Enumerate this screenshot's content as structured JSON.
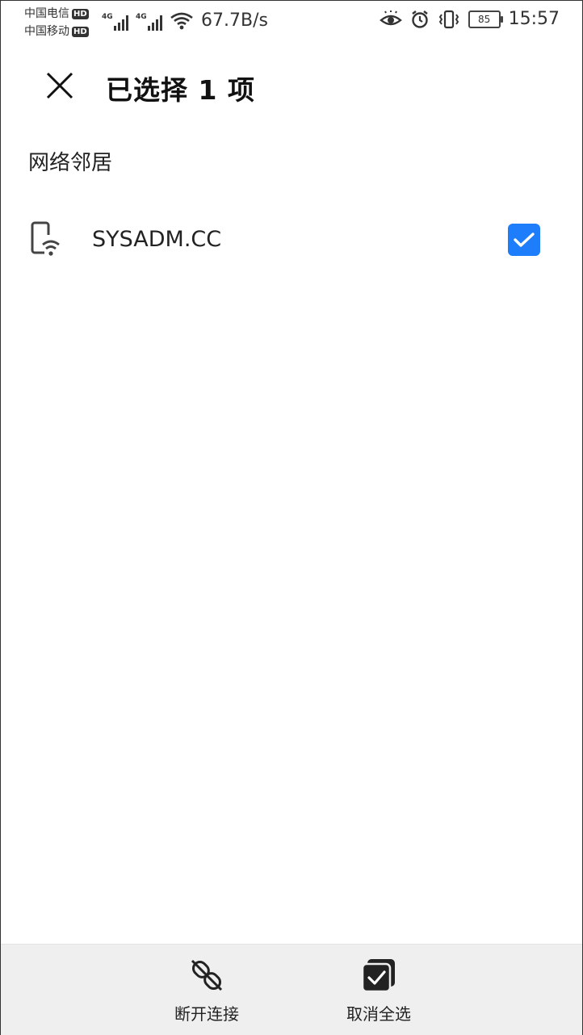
{
  "status_bar": {
    "carrier_1": "中国电信",
    "carrier_2": "中国移动",
    "hd_badge": "HD",
    "net_type": "4G",
    "speed": "67.7B/s",
    "battery": "85",
    "time": "15:57",
    "icons": [
      "eye-comfort-icon",
      "alarm-icon",
      "vibrate-icon",
      "battery-icon",
      "wifi-icon",
      "signal-icon"
    ]
  },
  "app_bar": {
    "title": "已选择 1 项",
    "close_icon": "close-icon"
  },
  "section": {
    "label": "网络邻居"
  },
  "devices": [
    {
      "name": "SYSADM.CC",
      "icon": "phone-wifi-icon",
      "checked": true
    }
  ],
  "bottom_bar": {
    "disconnect_label": "断开连接",
    "deselect_all_label": "取消全选",
    "disconnect_icon": "unlink-icon",
    "deselect_icon": "multi-check-icon"
  },
  "colors": {
    "accent": "#1d7dfb",
    "bottom_bar_bg": "#efefef",
    "text": "#222222"
  }
}
